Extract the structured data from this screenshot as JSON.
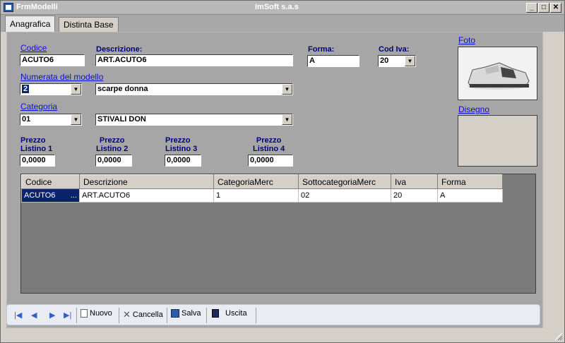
{
  "window": {
    "title_left": "FrmModelli",
    "title_center": "ImSoft s.a.s",
    "min": "_",
    "max": "□",
    "close": "✕"
  },
  "tabs": [
    {
      "label": "Anagrafica"
    },
    {
      "label": "Distinta Base"
    }
  ],
  "form": {
    "codice_label": "Codice",
    "codice_value": "ACUTO6",
    "descrizione_label": "Descrizione:",
    "descrizione_value": "ART.ACUTO6",
    "forma_label": "Forma:",
    "forma_value": "A",
    "codiva_label": "Cod Iva:",
    "codiva_value": "20",
    "foto_label": "Foto",
    "disegno_label": "Disegno",
    "numerata_label": "Numerata del modello",
    "numerata_value": "2",
    "numerata_desc": "scarpe donna",
    "categoria_label": "Categoria",
    "categoria_value": "01",
    "categoria_desc": "STIVALI DON",
    "prezzo1_label1": "Prezzo",
    "prezzo1_label2": "Listino 1",
    "prezzo1_value": "0,0000",
    "prezzo2_label1": "Prezzo",
    "prezzo2_label2": "Listino 2",
    "prezzo2_value": "0,0000",
    "prezzo3_label1": "Prezzo",
    "prezzo3_label2": "Listino 3",
    "prezzo3_value": "0,0000",
    "prezzo4_label1": "Prezzo",
    "prezzo4_label2": "Listino 4",
    "prezzo4_value": "0,0000"
  },
  "grid": {
    "columns": [
      "Codice",
      "Descrizione",
      "CategoriaMerc",
      "SottocategoriaMerc",
      "Iva",
      "Forma"
    ],
    "rows": [
      [
        "ACUTO6",
        "ART.ACUTO6",
        "1",
        "02",
        "20",
        "A"
      ]
    ],
    "ellipsis": "..."
  },
  "toolbar": {
    "nuovo": "Nuovo",
    "cancella": "Cancella",
    "salva": "Salva",
    "uscita": "Uscita"
  },
  "colors": {
    "link": "#1010d0",
    "label": "#00007a",
    "selection": "#0a246a"
  }
}
